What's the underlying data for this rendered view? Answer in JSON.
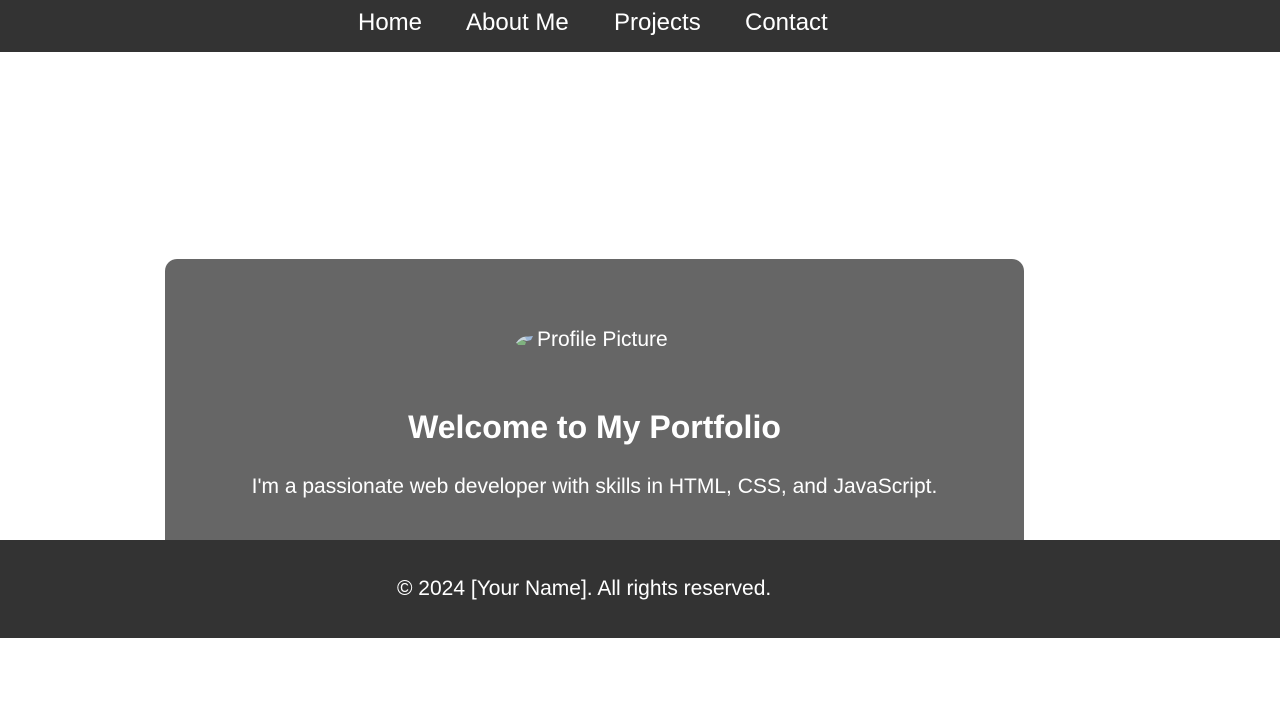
{
  "nav": {
    "items": [
      {
        "label": "Home"
      },
      {
        "label": "About Me"
      },
      {
        "label": "Projects"
      },
      {
        "label": "Contact"
      }
    ]
  },
  "hero": {
    "profile_picture_alt": "Profile Picture",
    "profile_picture_icon": "broken-image-icon",
    "title": "Welcome to My Portfolio",
    "description": "I'm a passionate web developer with skills in HTML, CSS, and JavaScript."
  },
  "footer": {
    "text": "© 2024 [Your Name]. All rights reserved."
  },
  "colors": {
    "nav_background": "#333333",
    "hero_background": "#666666",
    "footer_background": "#333333",
    "text": "#ffffff",
    "page_background": "#ffffff"
  }
}
